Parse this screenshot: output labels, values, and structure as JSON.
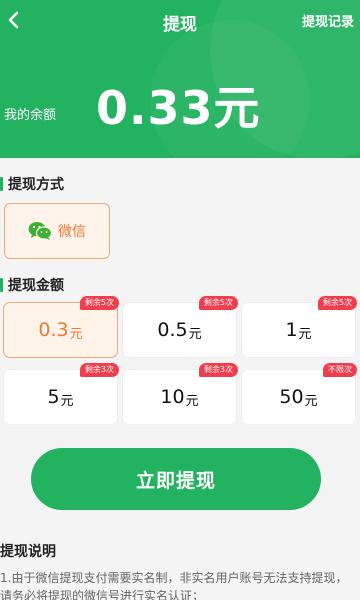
{
  "header": {
    "title": "提现",
    "record_link": "提现记录",
    "balance_label": "我的余额",
    "balance_amount": "0.33元",
    "bg_color": "#23b25f"
  },
  "method_section": {
    "title": "提现方式",
    "option": {
      "label": "微信",
      "icon": "wechat-icon"
    }
  },
  "amount_section": {
    "title": "提现金额",
    "options": [
      {
        "value": "0.3",
        "unit": "元",
        "badge": "剩余5次",
        "selected": true
      },
      {
        "value": "0.5",
        "unit": "元",
        "badge": "剩余5次",
        "selected": false
      },
      {
        "value": "1",
        "unit": "元",
        "badge": "剩余5次",
        "selected": false
      },
      {
        "value": "5",
        "unit": "元",
        "badge": "剩余3次",
        "selected": false
      },
      {
        "value": "10",
        "unit": "元",
        "badge": "剩余3次",
        "selected": false
      },
      {
        "value": "50",
        "unit": "元",
        "badge": "不限次",
        "selected": false
      }
    ]
  },
  "submit_label": "立即提现",
  "notes": {
    "title": "提现说明",
    "text": "1.由于微信提现支付需要实名制，非实名用户账号无法支持提现，请务必将提现的微信号进行实名认证；"
  },
  "colors": {
    "accent": "#23b25f",
    "selected_orange": "#f07a35",
    "badge_red": "#f03e4e"
  }
}
